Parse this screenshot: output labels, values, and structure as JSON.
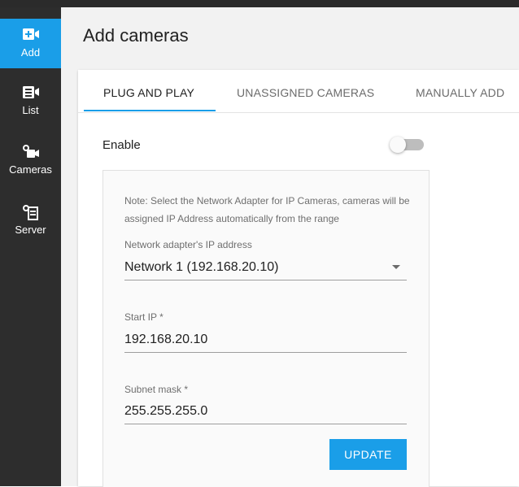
{
  "sidebar": {
    "items": [
      {
        "label": "Add",
        "icon": "add-camera-icon",
        "active": true
      },
      {
        "label": "List",
        "icon": "camera-list-icon",
        "active": false
      },
      {
        "label": "Cameras",
        "icon": "cameras-icon",
        "active": false
      },
      {
        "label": "Server",
        "icon": "server-icon",
        "active": false
      }
    ]
  },
  "page": {
    "title": "Add cameras"
  },
  "tabs": [
    {
      "label": "PLUG AND PLAY",
      "active": true
    },
    {
      "label": "UNASSIGNED CAMERAS",
      "active": false
    },
    {
      "label": "MANUALLY ADD",
      "active": false
    }
  ],
  "enable": {
    "label": "Enable",
    "on": false
  },
  "note": "Note: Select the Network Adapter for IP Cameras, cameras will be assigned IP Address automatically from the range",
  "fields": {
    "adapter": {
      "label": "Network adapter's IP address",
      "value": "Network 1 (192.168.20.10)"
    },
    "start_ip": {
      "label": "Start IP *",
      "value": "192.168.20.10"
    },
    "subnet": {
      "label": "Subnet mask *",
      "value": "255.255.255.0"
    }
  },
  "update_button": {
    "label": "UPDATE"
  },
  "colors": {
    "accent": "#1a9ee8",
    "sidebar": "#2d2d2d",
    "background": "#f2f2f2"
  }
}
